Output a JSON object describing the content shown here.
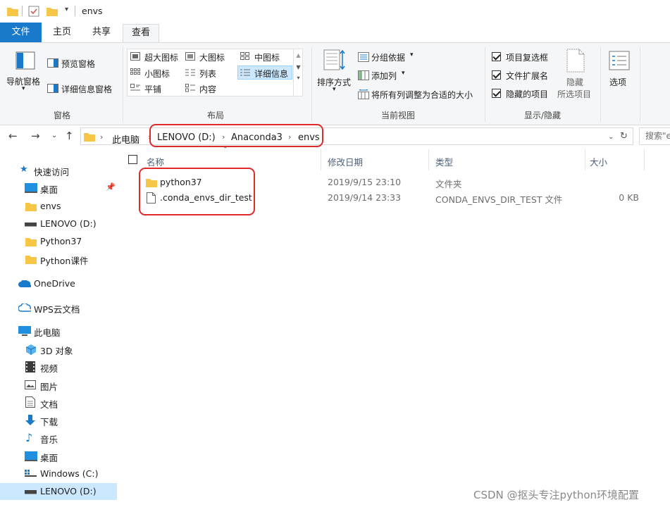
{
  "window": {
    "title": "envs"
  },
  "tabs": {
    "file": "文件",
    "home": "主页",
    "share": "共享",
    "view": "查看"
  },
  "ribbon": {
    "panes": {
      "nav_pane": "导航窗格",
      "preview_pane": "预览窗格",
      "details_pane": "详细信息窗格",
      "group": "窗格"
    },
    "layout": {
      "extra_large": "超大图标",
      "large": "大图标",
      "medium": "中图标",
      "small": "小图标",
      "list": "列表",
      "details": "详细信息",
      "tiles": "平铺",
      "content": "内容",
      "group": "布局"
    },
    "current_view": {
      "sort_by": "排序方式",
      "group_by": "分组依据",
      "add_columns": "添加列",
      "fit_columns": "将所有列调整为合适的大小",
      "group": "当前视图"
    },
    "show_hide": {
      "item_checkboxes": "项目复选框",
      "file_extensions": "文件扩展名",
      "hidden_items": "隐藏的项目",
      "hide": "隐藏",
      "selected_items": "所选项目",
      "group": "显示/隐藏"
    },
    "options": "选项"
  },
  "address": {
    "crumbs": [
      "此电脑",
      "LENOVO (D:)",
      "Anaconda3",
      "envs"
    ],
    "search_placeholder": "搜索\"e"
  },
  "sidebar": {
    "items": [
      {
        "label": "快速访问",
        "icon": "star-icon"
      },
      {
        "label": "桌面",
        "icon": "desktop-icon"
      },
      {
        "label": "envs",
        "icon": "folder-icon"
      },
      {
        "label": "LENOVO (D:)",
        "icon": "drive-icon"
      },
      {
        "label": "Python37",
        "icon": "folder-icon"
      },
      {
        "label": "Python课件",
        "icon": "folder-icon"
      },
      {
        "label": "OneDrive",
        "icon": "cloud-icon"
      },
      {
        "label": "WPS云文档",
        "icon": "wps-cloud-icon"
      },
      {
        "label": "此电脑",
        "icon": "computer-icon"
      },
      {
        "label": "3D 对象",
        "icon": "cube-icon"
      },
      {
        "label": "视频",
        "icon": "video-icon"
      },
      {
        "label": "图片",
        "icon": "picture-icon"
      },
      {
        "label": "文档",
        "icon": "document-icon"
      },
      {
        "label": "下载",
        "icon": "download-icon"
      },
      {
        "label": "音乐",
        "icon": "music-icon"
      },
      {
        "label": "桌面",
        "icon": "desktop-icon"
      },
      {
        "label": "Windows (C:)",
        "icon": "windows-drive-icon"
      },
      {
        "label": "LENOVO (D:)",
        "icon": "drive-icon"
      }
    ]
  },
  "columns": {
    "name": "名称",
    "modified": "修改日期",
    "type": "类型",
    "size": "大小"
  },
  "files": [
    {
      "name": "python37",
      "modified": "2019/9/15 23:10",
      "type": "文件夹",
      "size": ""
    },
    {
      "name": ".conda_envs_dir_test",
      "modified": "2019/9/14 23:33",
      "type": "CONDA_ENVS_DIR_TEST 文件",
      "size": "0 KB"
    }
  ],
  "watermark": "CSDN @抠头专注python环境配置",
  "colors": {
    "accent": "#1979ca",
    "highlight": "#e02a2a",
    "selection": "#cce8ff",
    "folder": "#f7c646"
  }
}
